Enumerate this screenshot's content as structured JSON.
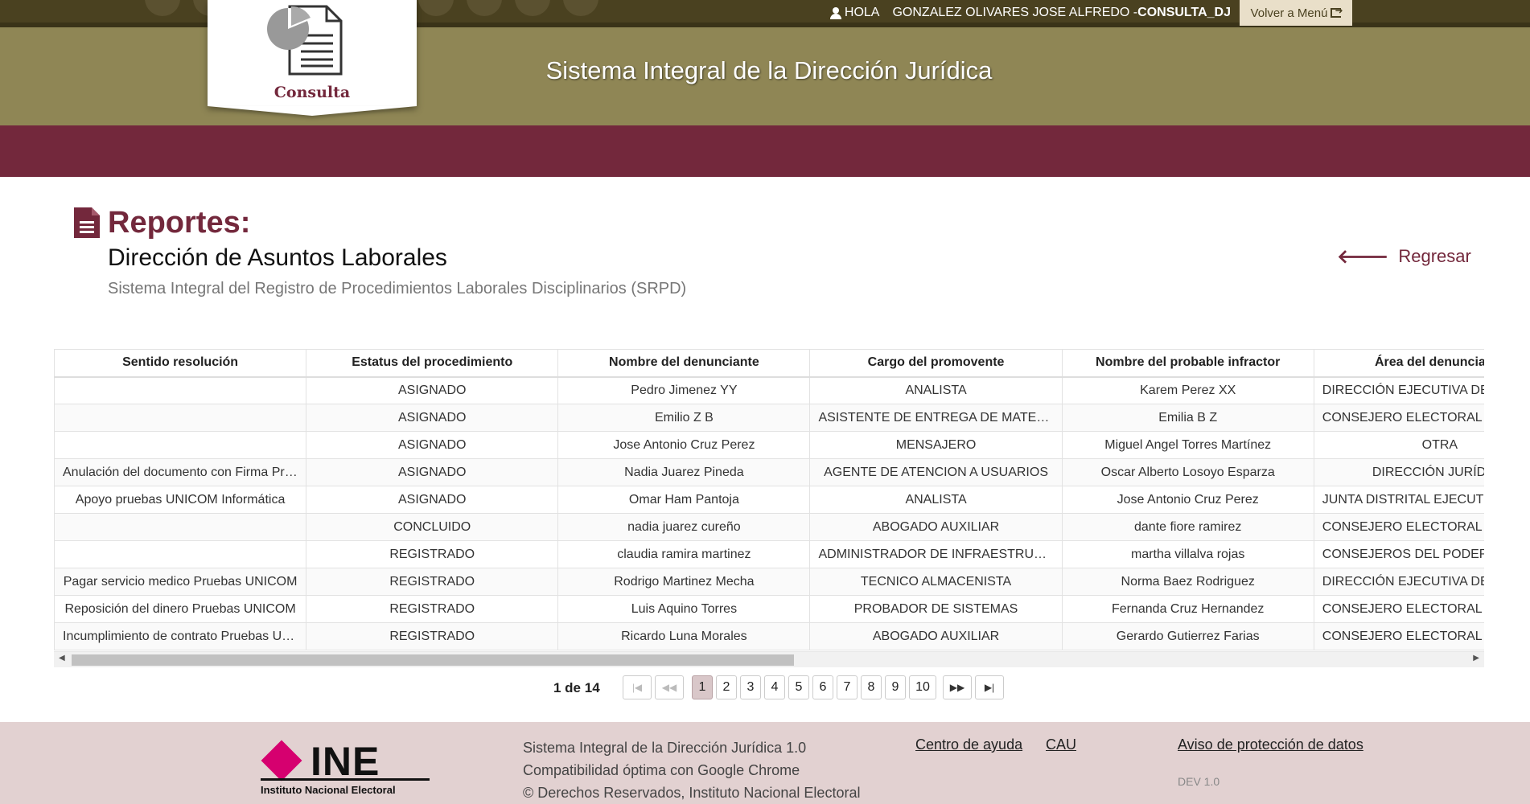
{
  "header": {
    "user_greeting": "HOLA",
    "user_name": "GONZALEZ OLIVARES JOSE ALFREDO - ",
    "user_role": "CONSULTA_DJ",
    "back_to_menu": "Volver a Menú",
    "system_title": "Sistema Integral de la Dirección Jurídica",
    "module_label": "Consulta"
  },
  "page": {
    "title": "Reportes:",
    "subtitle": "Dirección de Asuntos Laborales",
    "description": "Sistema Integral del Registro de Procedimientos Laborales Disciplinarios (SRPD)",
    "back_label": "Regresar"
  },
  "table": {
    "columns": [
      "Sentido resolución",
      "Estatus del procedimiento",
      "Nombre del denunciante",
      "Cargo del promovente",
      "Nombre del probable infractor",
      "Área del denunciante"
    ],
    "rows": [
      [
        "",
        "ASIGNADO",
        "Pedro Jimenez YY",
        "ANALISTA",
        "Karem Perez XX",
        "DIRECCIÓN EJECUTIVA DE ADMINISTRACIÓN"
      ],
      [
        "",
        "ASIGNADO",
        "Emilio Z B",
        "ASISTENTE DE ENTREGA DE MATERIALES",
        "Emilia B Z",
        "CONSEJERO ELECTORAL"
      ],
      [
        "",
        "ASIGNADO",
        "Jose Antonio Cruz Perez",
        "MENSAJERO",
        "Miguel Angel Torres Martínez",
        "OTRA"
      ],
      [
        "Anulación del documento con Firma Pruebas",
        "ASIGNADO",
        "Nadia Juarez Pineda",
        "AGENTE DE ATENCION A USUARIOS",
        "Oscar Alberto Losoyo Esparza",
        "DIRECCIÓN JURÍDICA"
      ],
      [
        "Apoyo pruebas UNICOM Informática",
        "ASIGNADO",
        "Omar Ham Pantoja",
        "ANALISTA",
        "Jose Antonio Cruz Perez",
        "JUNTA DISTRITAL EJECUTIVA"
      ],
      [
        "",
        "CONCLUIDO",
        "nadia juarez cureño",
        "ABOGADO AUXILIAR",
        "dante fiore ramirez",
        "CONSEJERO ELECTORAL"
      ],
      [
        "",
        "REGISTRADO",
        "claudia ramira martinez",
        "ADMINISTRADOR DE INFRAESTRUCTURA",
        "martha villalva rojas",
        "CONSEJEROS DEL PODER LEGISLATIVO"
      ],
      [
        "Pagar servicio medico Pruebas UNICOM",
        "REGISTRADO",
        "Rodrigo Martinez Mecha",
        "TECNICO ALMACENISTA",
        "Norma Baez Rodriguez",
        "DIRECCIÓN EJECUTIVA DE ADMINISTRACIÓN"
      ],
      [
        "Reposición del dinero Pruebas UNICOM",
        "REGISTRADO",
        "Luis Aquino Torres",
        "PROBADOR DE SISTEMAS",
        "Fernanda Cruz Hernandez",
        "CONSEJERO ELECTORAL"
      ],
      [
        "Incumplimiento de contrato Pruebas UNICOM",
        "REGISTRADO",
        "Ricardo Luna Morales",
        "ABOGADO AUXILIAR",
        "Gerardo Gutierrez Farias",
        "CONSEJERO ELECTORAL"
      ]
    ]
  },
  "pagination": {
    "info": "1 de 14",
    "current": 1,
    "pages": [
      "1",
      "2",
      "3",
      "4",
      "5",
      "6",
      "7",
      "8",
      "9",
      "10"
    ],
    "first_icon": "first-page-icon",
    "prev_icon": "prev-page-icon",
    "next_icon": "next-page-icon",
    "last_icon": "last-page-icon"
  },
  "footer": {
    "logo_text": "INE",
    "logo_subtitle": "Instituto Nacional Electoral",
    "info_lines": [
      "Sistema Integral de la Dirección Jurídica 1.0",
      "Compatibilidad óptima con Google Chrome",
      "© Derechos Reservados, Instituto Nacional Electoral"
    ],
    "links": [
      "Centro de ayuda",
      "CAU",
      "Aviso de protección de datos"
    ],
    "version": "DEV 1.0"
  },
  "colors": {
    "brand_maroon": "#73283c",
    "header_olive": "#8f8655",
    "topbar_dark": "#4a4120",
    "footer_bg": "#e2d1d1",
    "ine_magenta": "#d6006f"
  }
}
